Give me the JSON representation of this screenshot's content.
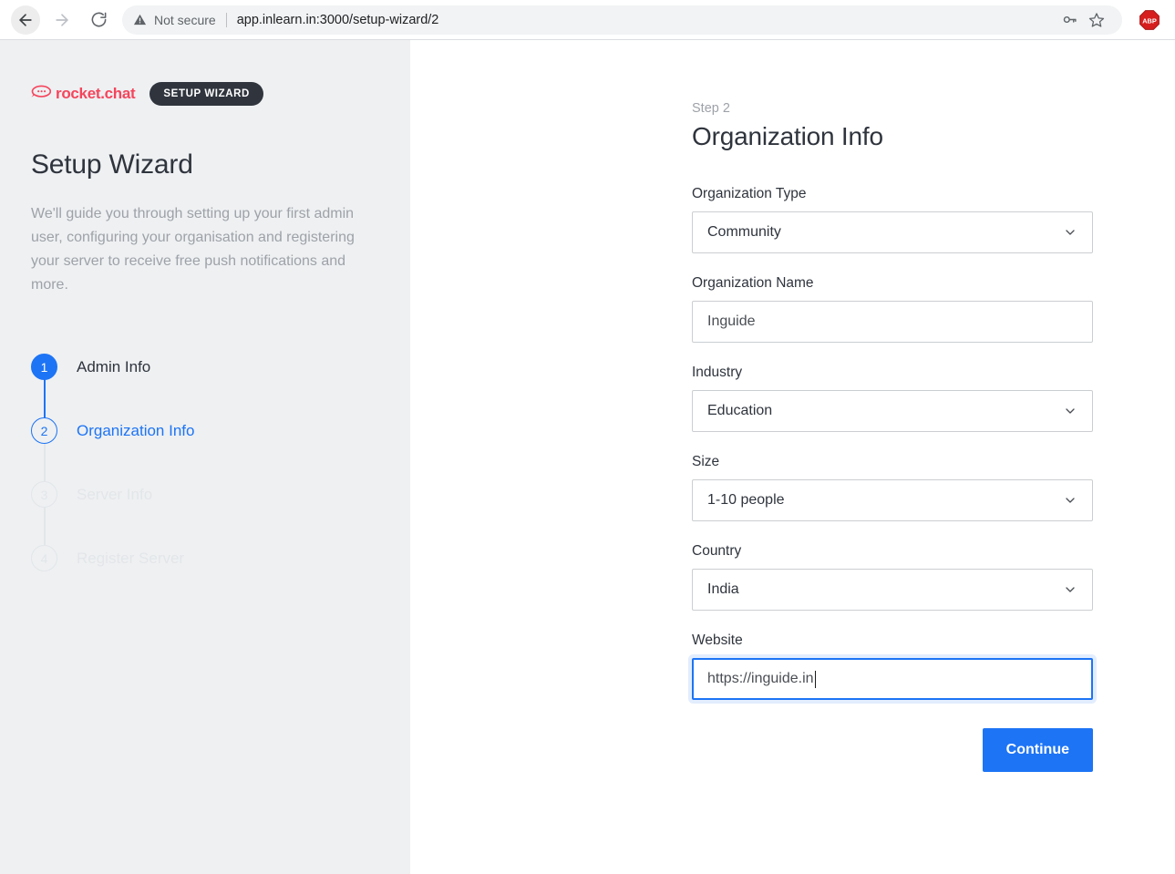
{
  "browser": {
    "back_icon": "arrow-left-icon",
    "forward_icon": "arrow-right-icon",
    "reload_icon": "reload-icon",
    "security_icon": "warning-triangle-icon",
    "security_label": "Not secure",
    "url_host": "app.inlearn.in:3000",
    "url_path": "/setup-wizard/2",
    "url_full": "app.inlearn.in:3000/setup-wizard/2",
    "save_password_icon": "key-icon",
    "bookmark_icon": "star-icon",
    "extension_icon": "abp-icon",
    "extension_label": "ABP"
  },
  "sidebar": {
    "logo_icon": "rocketchat-logo-icon",
    "logo_word": "rocket.chat",
    "wizard_badge": "SETUP WIZARD",
    "title": "Setup Wizard",
    "description": "We'll guide you through setting up your first admin user, configuring your organisation and registering your server to receive free push notifications and more.",
    "steps": [
      {
        "number": "1",
        "label": "Admin Info",
        "state": "done"
      },
      {
        "number": "2",
        "label": "Organization Info",
        "state": "active"
      },
      {
        "number": "3",
        "label": "Server Info",
        "state": "pending"
      },
      {
        "number": "4",
        "label": "Register Server",
        "state": "pending"
      }
    ]
  },
  "main": {
    "eyebrow": "Step 2",
    "heading": "Organization Info",
    "fields": [
      {
        "label": "Organization Type",
        "value": "Community",
        "type": "select"
      },
      {
        "label": "Organization Name",
        "value": "Inguide",
        "type": "text"
      },
      {
        "label": "Industry",
        "value": "Education",
        "type": "select"
      },
      {
        "label": "Size",
        "value": "1-10 people",
        "type": "select"
      },
      {
        "label": "Country",
        "value": "India",
        "type": "select"
      },
      {
        "label": "Website",
        "value": "https://inguide.in",
        "type": "text"
      }
    ],
    "continue_label": "Continue"
  },
  "colors": {
    "accent_blue": "#1d74f5",
    "brand_red": "#F5455C",
    "sidebar_bg": "#eef0f2",
    "text_dark": "#2f343d",
    "text_muted": "#9ea2a8",
    "border": "#cbced1"
  }
}
